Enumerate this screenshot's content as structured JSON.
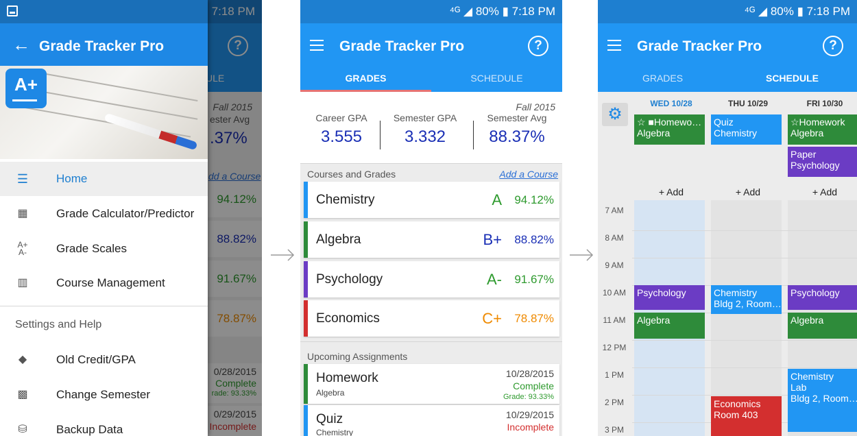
{
  "status": {
    "text": "⁴ᴳ ◢ 80% ▮ 7:18 PM"
  },
  "app": {
    "title": "Grade Tracker Pro",
    "help": "?"
  },
  "tabs": {
    "grades": "GRADES",
    "schedule": "SCHEDULE"
  },
  "drawer": {
    "logo": "A+",
    "items": [
      {
        "label": "Home",
        "icon": "home-icon"
      },
      {
        "label": "Grade Calculator/Predictor",
        "icon": "calculator-icon"
      },
      {
        "label": "Grade Scales",
        "icon": "grade-scale-icon"
      },
      {
        "label": "Course Management",
        "icon": "courses-icon"
      }
    ],
    "section": "Settings and Help",
    "items2": [
      {
        "label": "Old Credit/GPA",
        "icon": "graduation-cap-icon"
      },
      {
        "label": "Change Semester",
        "icon": "semester-icon"
      },
      {
        "label": "Backup Data",
        "icon": "backup-icon"
      }
    ]
  },
  "behind": {
    "tab_fragment": "ULE",
    "fall": "Fall 2015",
    "sem_avg_fragment": "ester Avg",
    "sem_avg_val": ".37%",
    "add_fragment": "dd a Course",
    "pcts": [
      "94.12%",
      "88.82%",
      "91.67%",
      "78.87%"
    ],
    "a1_date": "0/28/2015",
    "a1_status": "Complete",
    "a1_grade": "rade: 93.33%",
    "a2_date": "0/29/2015",
    "a2_status": "Incomplete"
  },
  "grades": {
    "term": "Fall 2015",
    "career_label": "Career GPA",
    "career_val": "3.555",
    "semester_label": "Semester GPA",
    "semester_val": "3.332",
    "avg_label": "Semester Avg",
    "avg_val": "88.37%",
    "courses_header": "Courses and Grades",
    "add_course": "Add a Course",
    "courses": [
      {
        "name": "Chemistry",
        "grade": "A",
        "pct": "94.12%",
        "color": "#2196f3",
        "gcolor": "#2e9a2e"
      },
      {
        "name": "Algebra",
        "grade": "B+",
        "pct": "88.82%",
        "color": "#2e8b3a",
        "gcolor": "#1a2fb5"
      },
      {
        "name": "Psychology",
        "grade": "A-",
        "pct": "91.67%",
        "color": "#6b3cc4",
        "gcolor": "#2e9a2e"
      },
      {
        "name": "Economics",
        "grade": "C+",
        "pct": "78.87%",
        "color": "#d32f2f",
        "gcolor": "#ef8a00"
      }
    ],
    "upcoming_header": "Upcoming Assignments",
    "assignments": [
      {
        "name": "Homework",
        "course": "Algebra",
        "date": "10/28/2015",
        "status": "Complete",
        "grade": "Grade: 93.33%",
        "color": "#2e8b3a"
      },
      {
        "name": "Quiz",
        "course": "Chemistry",
        "date": "10/29/2015",
        "status": "Incomplete",
        "color": "#2196f3"
      }
    ]
  },
  "schedule": {
    "days": [
      "WED 10/28",
      "THU 10/29",
      "FRI 10/30"
    ],
    "top_events": {
      "wed": "☆ ■Homewo…\nAlgebra",
      "thu": "Quiz\nChemistry",
      "fri1": "☆Homework\nAlgebra",
      "fri2": "Paper\nPsychology"
    },
    "add": "+ Add",
    "hours": [
      "7 AM",
      "8 AM",
      "9 AM",
      "10 AM",
      "11 AM",
      "12 PM",
      "1 PM",
      "2 PM",
      "3 PM"
    ],
    "events": {
      "wed_psy": "Psychology",
      "wed_alg": "Algebra",
      "thu_chem": "Chemistry\nBldg 2, Room…",
      "thu_econ": "Economics\nRoom 403",
      "fri_psy": "Psychology",
      "fri_alg": "Algebra",
      "fri_lab": "Chemistry\nLab\nBldg 2, Room…"
    }
  }
}
